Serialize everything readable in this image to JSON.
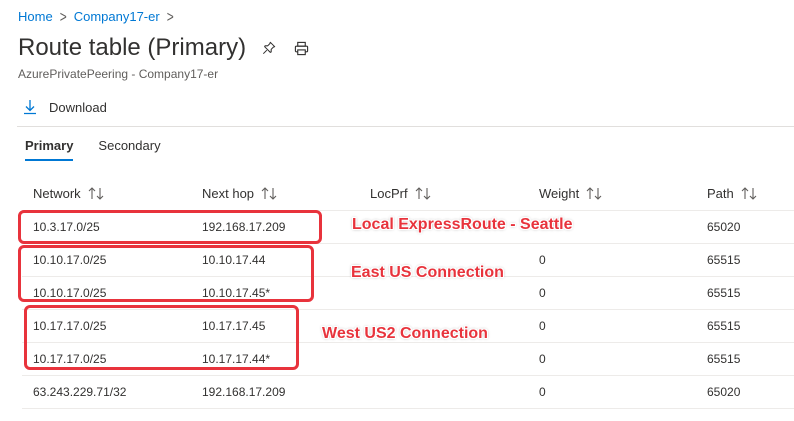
{
  "breadcrumb": {
    "home": "Home",
    "current": "Company17-er",
    "separator": ">"
  },
  "page": {
    "title": "Route table (Primary)",
    "subtitle": "AzurePrivatePeering - Company17-er"
  },
  "toolbar": {
    "download_label": "Download"
  },
  "tabs": [
    {
      "label": "Primary",
      "active": true
    },
    {
      "label": "Secondary",
      "active": false
    }
  ],
  "table": {
    "columns": [
      "Network",
      "Next hop",
      "LocPrf",
      "Weight",
      "Path"
    ],
    "rows": [
      {
        "network": "10.3.17.0/25",
        "next_hop": "192.168.17.209",
        "locprf": "",
        "weight": "",
        "path": "65020"
      },
      {
        "network": "10.10.17.0/25",
        "next_hop": "10.10.17.44",
        "locprf": "",
        "weight": "0",
        "path": "65515"
      },
      {
        "network": "10.10.17.0/25",
        "next_hop": "10.10.17.45*",
        "locprf": "",
        "weight": "0",
        "path": "65515"
      },
      {
        "network": "10.17.17.0/25",
        "next_hop": "10.17.17.45",
        "locprf": "",
        "weight": "0",
        "path": "65515"
      },
      {
        "network": "10.17.17.0/25",
        "next_hop": "10.17.17.44*",
        "locprf": "",
        "weight": "0",
        "path": "65515"
      },
      {
        "network": "63.243.229.71/32",
        "next_hop": "192.168.17.209",
        "locprf": "",
        "weight": "0",
        "path": "65020"
      }
    ]
  },
  "annotations": {
    "seattle": "Local ExpressRoute - Seattle",
    "east": "East US Connection",
    "west": "West US2 Connection"
  },
  "colors": {
    "accent": "#0078d4",
    "annotation": "#e8333c",
    "text": "#323130",
    "muted": "#605e5c"
  },
  "icons": {
    "pin": "pin-icon",
    "print": "print-icon",
    "download": "download-icon",
    "sort": "sort-icon"
  }
}
